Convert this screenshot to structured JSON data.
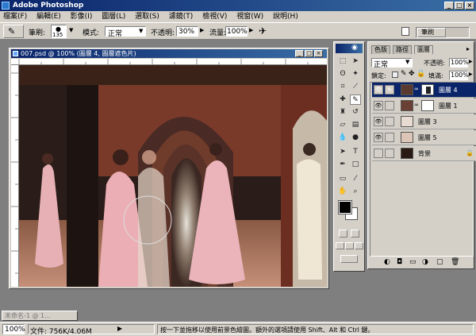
{
  "app": {
    "title": "Adobe Photoshop"
  },
  "menu": [
    "檔案(F)",
    "編輯(E)",
    "影像(I)",
    "圖層(L)",
    "選取(S)",
    "濾鏡(T)",
    "檢視(V)",
    "視窗(W)",
    "說明(H)"
  ],
  "options": {
    "brush_label": "筆刷:",
    "brush_size": "135",
    "mode_label": "模式:",
    "mode_value": "正常",
    "opacity_label": "不透明:",
    "opacity_value": "30%",
    "flow_label": "流量:",
    "flow_value": "100%"
  },
  "palette_well": {
    "tab": "筆刷"
  },
  "document": {
    "title": "007.psd @ 100% (圖層 4, 圖層遮色片)"
  },
  "layers_panel": {
    "tabs": [
      "色版",
      "路徑",
      "圖層"
    ],
    "blend_mode": "正常",
    "opacity_label": "不透明:",
    "opacity_value": "100%",
    "lock_label": "鎖定:",
    "fill_label": "填滿:",
    "fill_value": "100%",
    "layers": [
      {
        "name": "圖層 4"
      },
      {
        "name": "圖層 1"
      },
      {
        "name": "圖層 3"
      },
      {
        "name": "圖層 5"
      },
      {
        "name": "背景"
      }
    ]
  },
  "taskbar": {
    "minimized_doc": "未命名-1 @ 1..."
  },
  "status": {
    "zoom": "100%",
    "doc_info": "文件: 756K/4.06M",
    "hint": "按一下並拖移以使用前景色繪圖。額外的選項請使用 Shift、Alt 和 Ctrl 鍵。"
  },
  "colors": {
    "titlebar": "#0a246a",
    "chrome": "#d4d0c8",
    "selection": "#0a246a",
    "workspace": "#7f7f7f",
    "foreground_color": "#000000",
    "background_color": "#ffffff"
  }
}
